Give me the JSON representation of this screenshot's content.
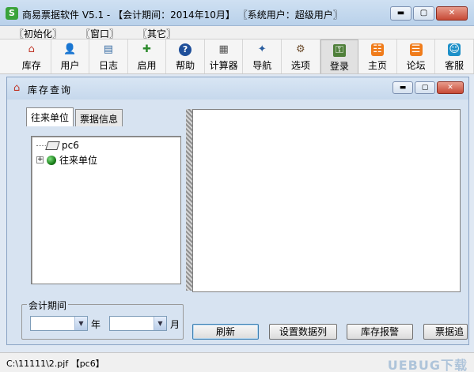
{
  "app": {
    "title": "商易票据软件 V5.1 - 【会计期间：2014年10月】 〖系统用户：超级用户〗",
    "window_buttons": {
      "minimize": "▬",
      "maximize": "▢",
      "close": "✕"
    }
  },
  "menu": [
    "〖初始化〗",
    "〖窗口〗",
    "〖其它〗"
  ],
  "toolbar": [
    {
      "label": "库存",
      "icon": "home-icon",
      "glyph": "⌂"
    },
    {
      "label": "用户",
      "icon": "user-icon",
      "glyph": "👤"
    },
    {
      "label": "日志",
      "icon": "log-icon",
      "glyph": "▤"
    },
    {
      "label": "启用",
      "icon": "enable-icon",
      "glyph": "✚"
    },
    {
      "label": "帮助",
      "icon": "help-icon",
      "glyph": "?"
    },
    {
      "label": "计算器",
      "icon": "calculator-icon",
      "glyph": "▦"
    },
    {
      "label": "导航",
      "icon": "navigation-icon",
      "glyph": "✦"
    },
    {
      "label": "选项",
      "icon": "options-icon",
      "glyph": "⚙"
    },
    {
      "label": "登录",
      "icon": "login-key-icon",
      "glyph": "⚿"
    },
    {
      "label": "主页",
      "icon": "rss-home-icon",
      "glyph": "☷"
    },
    {
      "label": "论坛",
      "icon": "forum-icon",
      "glyph": "☰"
    },
    {
      "label": "客服",
      "icon": "support-icon",
      "glyph": "☺"
    }
  ],
  "child_window": {
    "title": "库存查询",
    "tabs": [
      "往来单位",
      "票据信息"
    ],
    "tree": [
      {
        "label": "pc6",
        "type": "computer"
      },
      {
        "label": "往来单位",
        "type": "group",
        "expander": "+"
      }
    ],
    "period": {
      "legend": "会计期间",
      "year_value": "",
      "year_suffix": "年",
      "month_value": "",
      "month_suffix": "月"
    },
    "buttons": [
      "刷新",
      "设置数据列",
      "库存报警",
      "票据追"
    ]
  },
  "status": {
    "text": "C:\\11111\\2.pjf  【pc6】"
  },
  "watermark": "UEBUG下载"
}
